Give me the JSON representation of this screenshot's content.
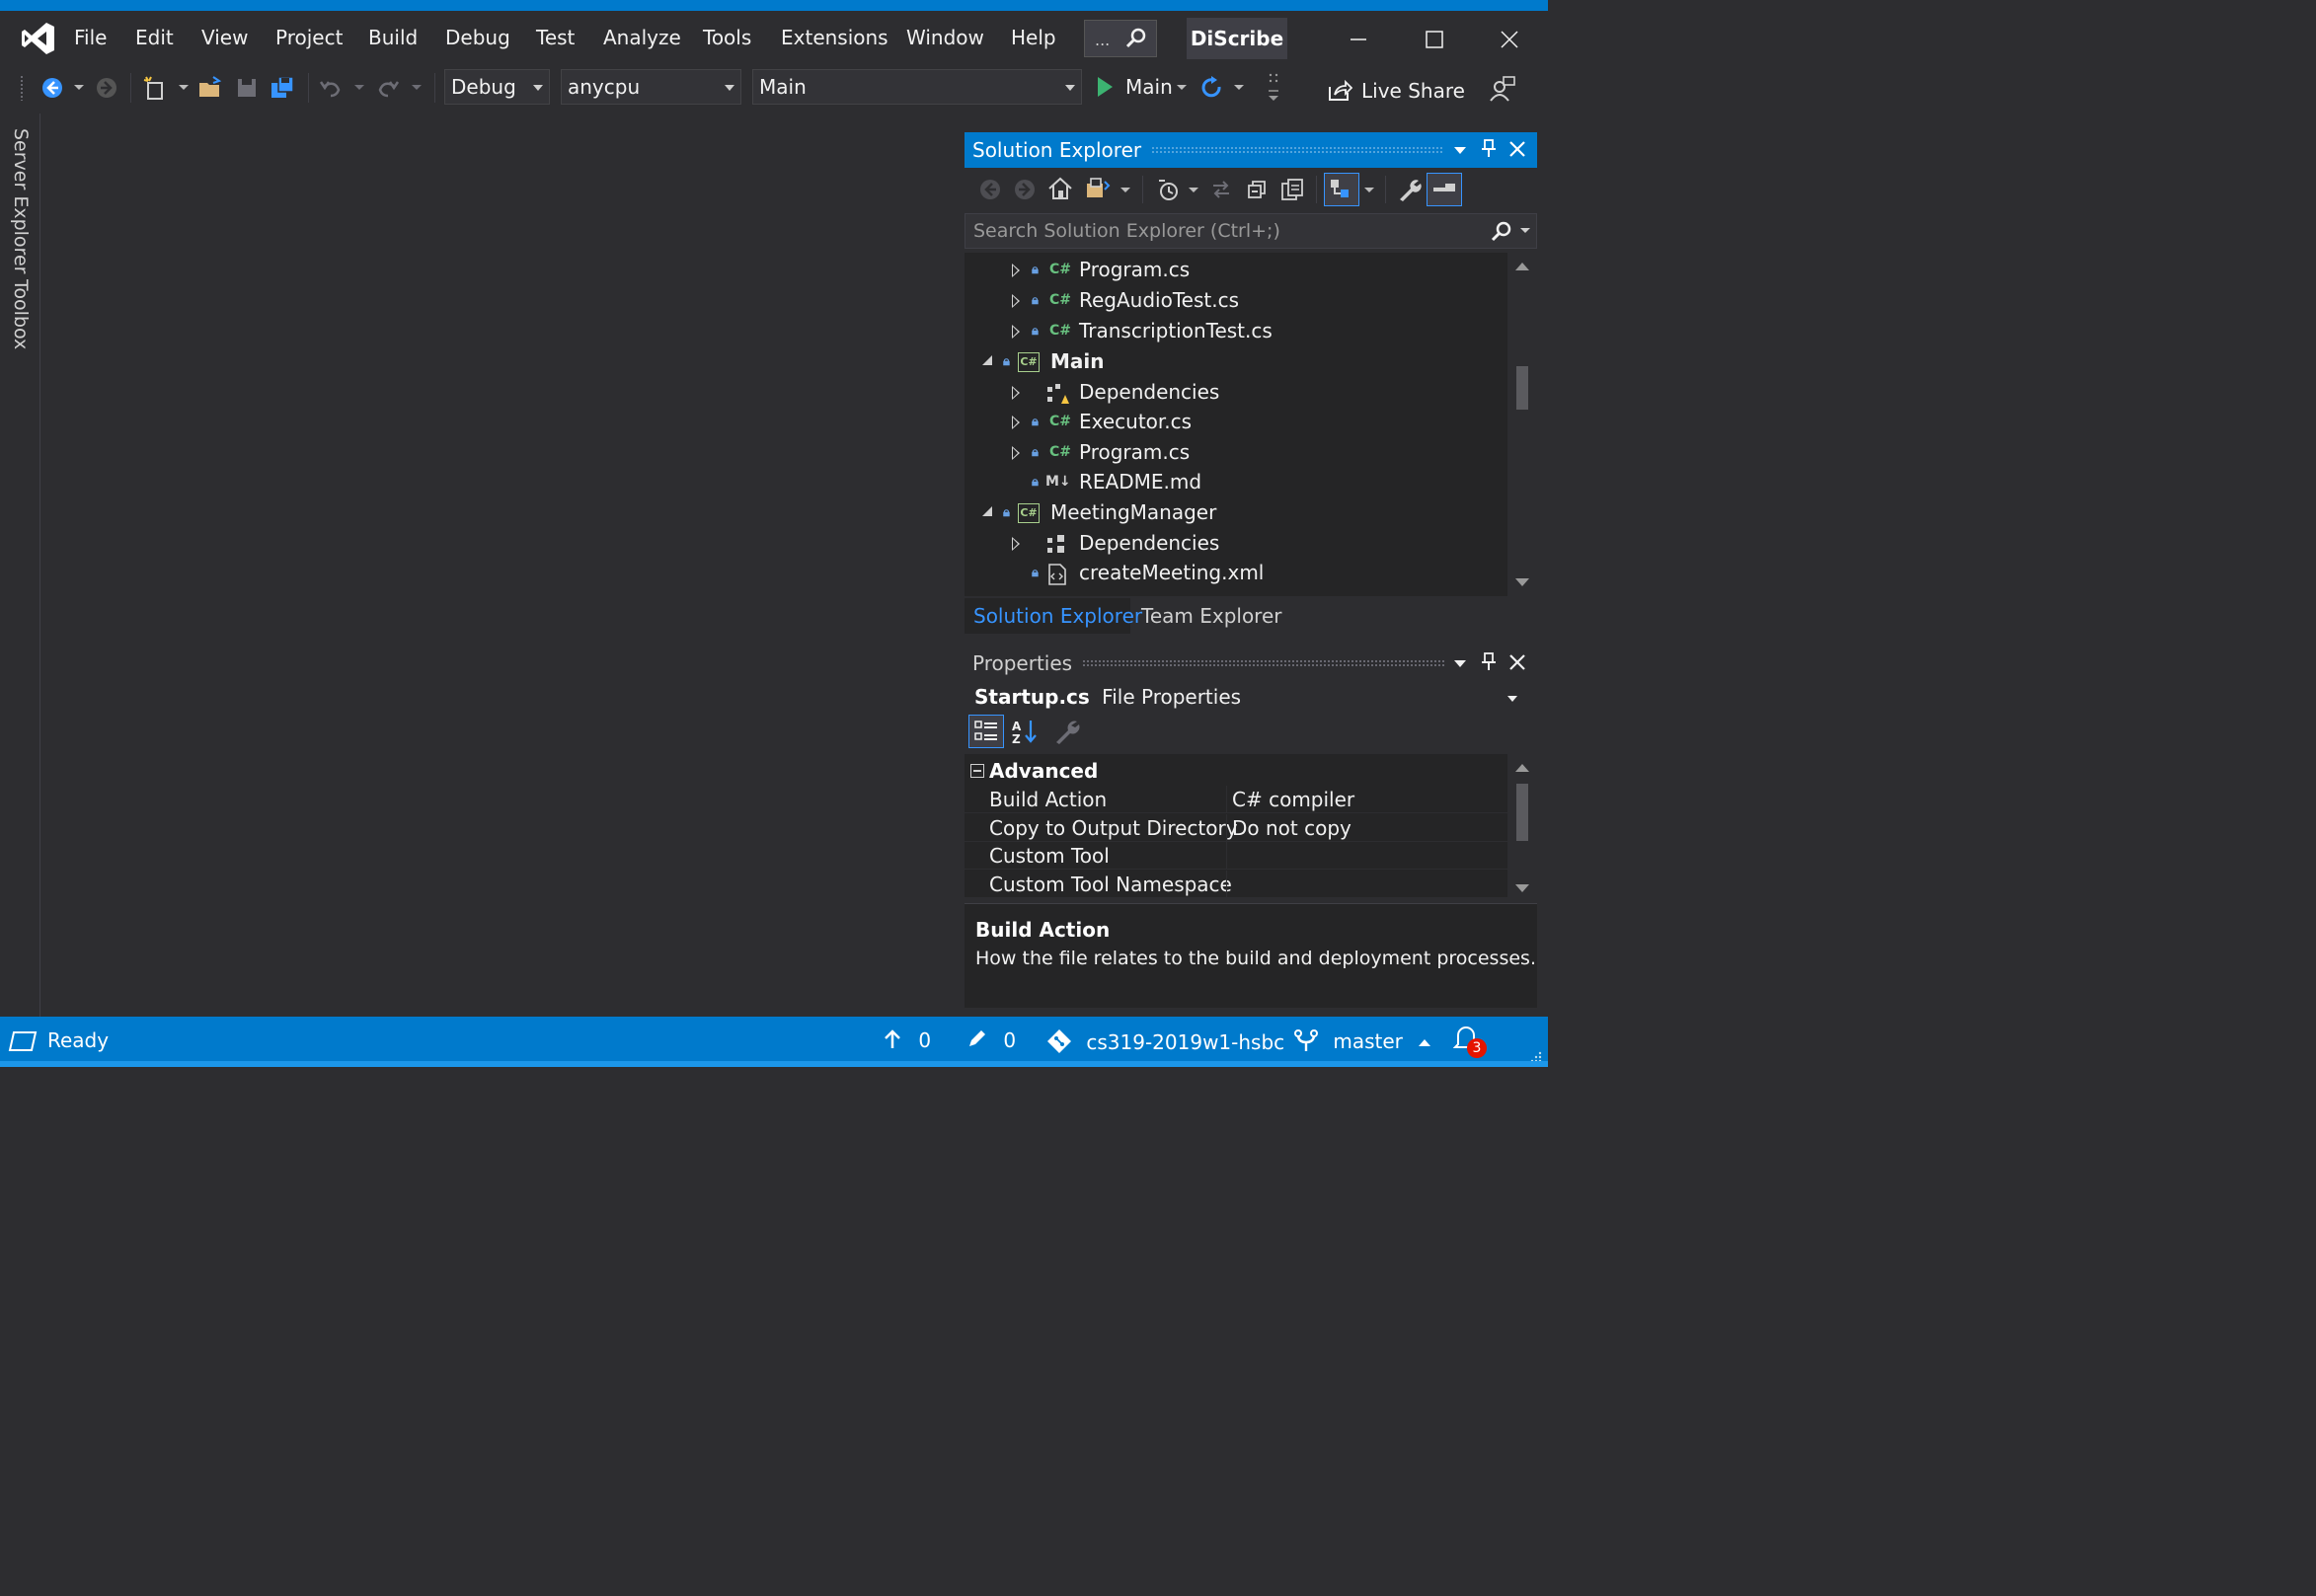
{
  "colors": {
    "accent": "#007acc",
    "background": "#2d2d30",
    "panel": "#252526",
    "panel_header_active": "#007acc",
    "run_green": "#3cb371",
    "badge_red": "#e51400"
  },
  "menu": [
    "File",
    "Edit",
    "View",
    "Project",
    "Build",
    "Debug",
    "Test",
    "Analyze",
    "Tools",
    "Extensions",
    "Window",
    "Help"
  ],
  "title": {
    "search_text": "...",
    "search_icon": "search-icon",
    "solution_name": "DiScribe"
  },
  "toolbar": {
    "config": "Debug",
    "platform": "anycpu",
    "startup_project": "Main",
    "run_label": "Main",
    "live_share": "Live Share"
  },
  "left_tabs": [
    "Server Explorer",
    "Toolbox"
  ],
  "solution_explorer": {
    "title": "Solution Explorer",
    "search_placeholder": "Search Solution Explorer (Ctrl+;)",
    "items": [
      {
        "label": "Program.cs",
        "type": "cs"
      },
      {
        "label": "RegAudioTest.cs",
        "type": "cs"
      },
      {
        "label": "TranscriptionTest.cs",
        "type": "cs"
      },
      {
        "label": "Main",
        "type": "project"
      },
      {
        "label": "Dependencies",
        "type": "deps-warning"
      },
      {
        "label": "Executor.cs",
        "type": "cs"
      },
      {
        "label": "Program.cs",
        "type": "cs"
      },
      {
        "label": "README.md",
        "type": "md"
      },
      {
        "label": "MeetingManager",
        "type": "project"
      },
      {
        "label": "Dependencies",
        "type": "deps"
      },
      {
        "label": "createMeeting.xml",
        "type": "xml"
      }
    ],
    "tabs": [
      "Solution Explorer",
      "Team Explorer"
    ]
  },
  "properties": {
    "title": "Properties",
    "object_name": "Startup.cs",
    "object_type": "File Properties",
    "category": "Advanced",
    "rows": [
      {
        "key": "Build Action",
        "value": "C# compiler"
      },
      {
        "key": "Copy to Output Directory",
        "value": "Do not copy"
      },
      {
        "key": "Custom Tool",
        "value": ""
      },
      {
        "key": "Custom Tool Namespace",
        "value": ""
      }
    ],
    "desc_title": "Build Action",
    "desc_text": "How the file relates to the build and deployment processes."
  },
  "status": {
    "ready": "Ready",
    "push_count": "0",
    "edit_count": "0",
    "repo": "cs319-2019w1-hsbc",
    "branch": "master",
    "notifications": "3"
  }
}
